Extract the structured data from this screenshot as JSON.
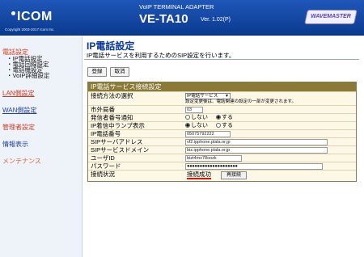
{
  "header": {
    "logo_text": "ICOM",
    "copyright": "Copyright 2003-2017 Icom Inc.",
    "product_subtitle": "VoIP TERMINAL ADAPTER",
    "product_name": "VE-TA10",
    "version": "Ver. 1.02(P)",
    "brand_badge": "WAVEMASTER"
  },
  "sidebar": {
    "phone_settings": "電話設定",
    "sub_items": [
      "IP電話設定",
      "電話回線設定",
      "電話機設定",
      "VoIP詳細設定"
    ],
    "lan_settings": "LAN側設定",
    "wan_settings": "WAN側設定",
    "admin_settings": "管理者設定",
    "info_display": "情報表示",
    "maintenance": "メンテナンス"
  },
  "main": {
    "title": "IP電話設定",
    "description": "IP電話サービスを利用するためのSIP設定を行います。",
    "save_label": "登録",
    "cancel_label": "取消",
    "section_title": "IP電話サービス接続設定",
    "rows": {
      "connection_method": {
        "label": "接続方法の選択",
        "selected": "IP電話サービス",
        "note": "設定変更後は、電話関連の設定の一部が変更されます。"
      },
      "area_code": {
        "label": "市外局番",
        "value": "03"
      },
      "caller_id_notify": {
        "label": "発信者番号通知",
        "options": [
          "しない",
          "する"
        ],
        "selected": 1
      },
      "incoming_lamp": {
        "label": "IP着信中ランプ表示",
        "options": [
          "しない",
          "する"
        ],
        "selected": 0
      },
      "ip_phone_number": {
        "label": "IP電話番号",
        "value": "05075792222"
      },
      "sip_server_address": {
        "label": "SIPサーバアドレス",
        "value": "vf2.ipphone.plala.or.jp"
      },
      "sip_server_domain": {
        "label": "SIPサービスドメイン",
        "value": "biz.ipphone.plala.or.jp"
      },
      "user_id": {
        "label": "ユーザID",
        "value": "bizt4mx78oozk"
      },
      "password": {
        "label": "パスワード",
        "value": "●●●●●●●●●●●●●●●●●●●●"
      },
      "connection_status": {
        "label": "接続状況",
        "value": "接続成功",
        "reconnect_label": "再接続"
      }
    }
  },
  "colors": {
    "header_bg": "#1f57b8",
    "sidebar_active": "#d23a1e",
    "sidebar_link": "#2240a8",
    "table_header": "#8a7a36",
    "table_bg": "#fdf8e6",
    "status_underline": "#e01010"
  }
}
